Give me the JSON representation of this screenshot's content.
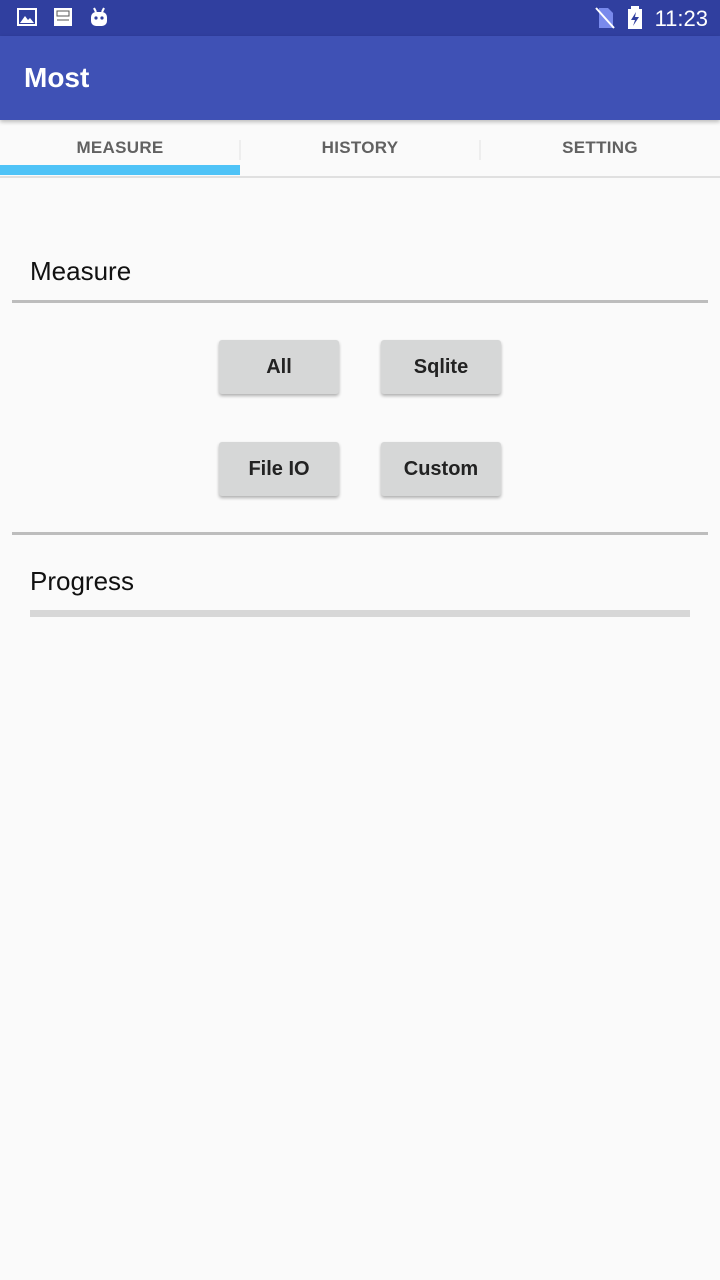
{
  "status_bar": {
    "time": "11:23",
    "icons": [
      "image-icon",
      "notification-app-icon",
      "android-icon",
      "no-sim-icon",
      "battery-charging-icon"
    ]
  },
  "app_bar": {
    "title": "Most"
  },
  "tabs": [
    {
      "label": "MEASURE",
      "selected": true
    },
    {
      "label": "HISTORY",
      "selected": false
    },
    {
      "label": "SETTING",
      "selected": false
    }
  ],
  "measure": {
    "title": "Measure",
    "buttons": {
      "all": "All",
      "sqlite": "Sqlite",
      "file_io": "File IO",
      "custom": "Custom"
    }
  },
  "progress": {
    "title": "Progress",
    "value": 0
  },
  "colors": {
    "status_bar": "#303f9f",
    "app_bar": "#3f51b5",
    "tab_indicator": "#4fc3f7",
    "button_bg": "#d6d7d7"
  }
}
